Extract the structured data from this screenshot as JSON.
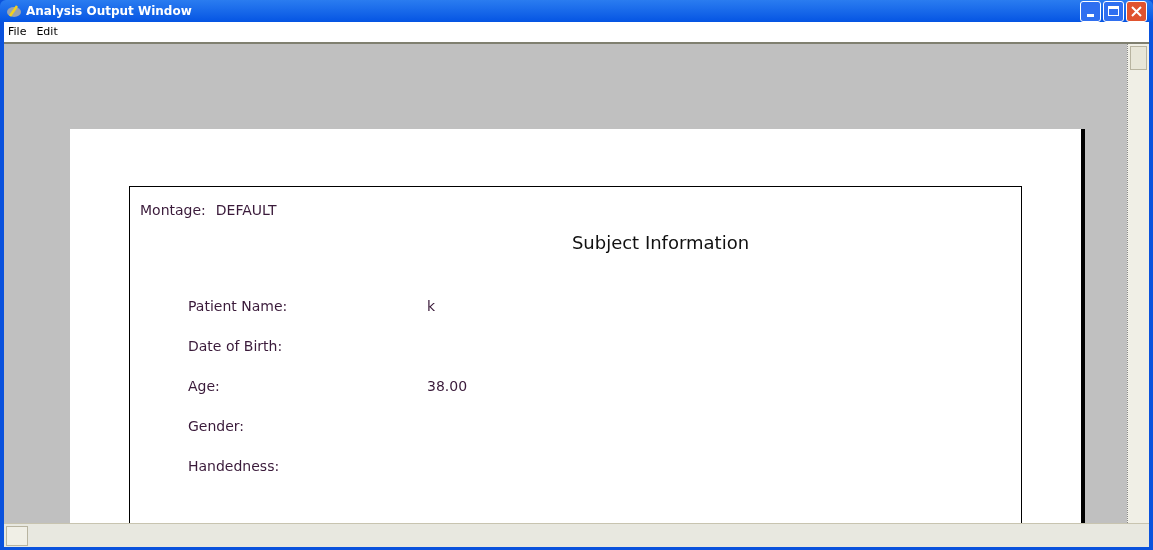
{
  "window": {
    "title": "Analysis Output Window"
  },
  "menu": [
    "File",
    "Edit"
  ],
  "report": {
    "montage_label": "Montage:",
    "montage_value": "DEFAULT",
    "heading": "Subject Information",
    "fields": [
      {
        "label": "Patient Name:",
        "value": "k"
      },
      {
        "label": "Date of Birth:"
      },
      {
        "label": "Age:",
        "value": "38.00"
      },
      {
        "label": "Gender:"
      },
      {
        "label": "Handedness:"
      }
    ]
  }
}
